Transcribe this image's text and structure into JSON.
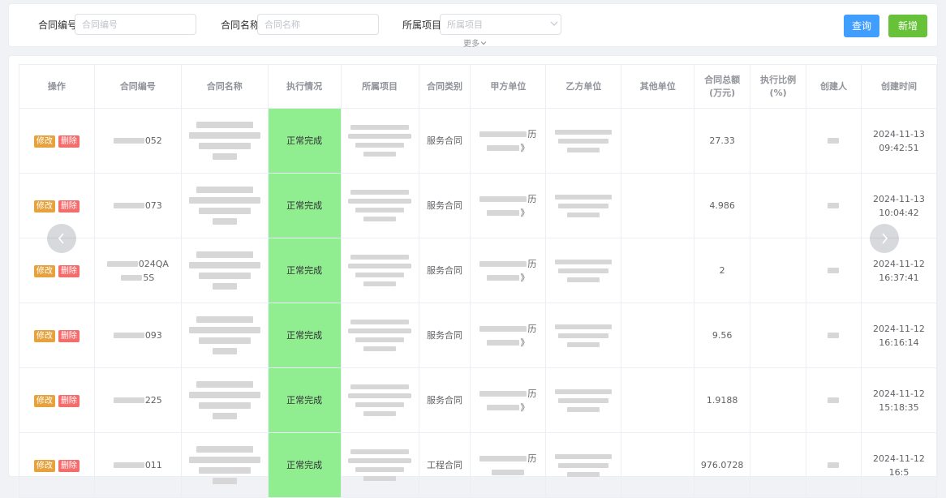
{
  "filters": {
    "contract_no": {
      "label": "合同编号",
      "placeholder": "合同编号"
    },
    "contract_name": {
      "label": "合同名称",
      "placeholder": "合同名称"
    },
    "project": {
      "label": "所属项目",
      "placeholder": "所属项目"
    },
    "more": "更多",
    "query_label": "查询",
    "add_label": "新增"
  },
  "colors": {
    "primary": "#409eff",
    "success": "#67c23a",
    "status_bg": "#90ee90",
    "edit_tag": "#e6a23c",
    "delete_tag": "#f56c6c"
  },
  "table": {
    "headers": [
      "操作",
      "合同编号",
      "合同名称",
      "执行情况",
      "所属项目",
      "合同类别",
      "甲方单位",
      "乙方单位",
      "其他单位",
      "合同总额(万元)",
      "执行比例(%)",
      "创建人",
      "创建时间"
    ],
    "edit_label": "修改",
    "delete_label": "删除",
    "rows": [
      {
        "no_suffix": "052",
        "status": "正常完成",
        "category": "服务合同",
        "party_a_suffix": "历",
        "party_a_line2_suffix": "》",
        "amount": "27.33",
        "created": "2024-11-13 09:42:51"
      },
      {
        "no_suffix": "073",
        "status": "正常完成",
        "category": "服务合同",
        "party_a_suffix": "历",
        "party_a_line2_suffix": "》",
        "amount": "4.986",
        "created": "2024-11-13 10:04:42"
      },
      {
        "no_suffix": "024QA",
        "no_line2_suffix": "5S",
        "status": "正常完成",
        "category": "服务合同",
        "party_a_suffix": "历",
        "party_a_line2_suffix": "》",
        "amount": "2",
        "created": "2024-11-12 16:37:41"
      },
      {
        "no_suffix": "093",
        "status": "正常完成",
        "category": "服务合同",
        "party_a_suffix": "历",
        "party_a_line2_suffix": "》",
        "amount": "9.56",
        "created": "2024-11-12 16:16:14"
      },
      {
        "no_suffix": "225",
        "status": "正常完成",
        "category": "服务合同",
        "party_a_suffix": "历",
        "party_a_line2_suffix": "》",
        "amount": "1.9188",
        "created": "2024-11-12 15:18:35"
      },
      {
        "no_suffix": "011",
        "status": "正常完成",
        "category": "工程合同",
        "party_a_suffix": "历",
        "party_a_line2_suffix": "",
        "amount": "976.0728",
        "created": "2024-11-12 16:5"
      }
    ]
  },
  "carousel": {
    "prev_icon": "chevron-left-icon",
    "next_icon": "chevron-right-icon"
  }
}
